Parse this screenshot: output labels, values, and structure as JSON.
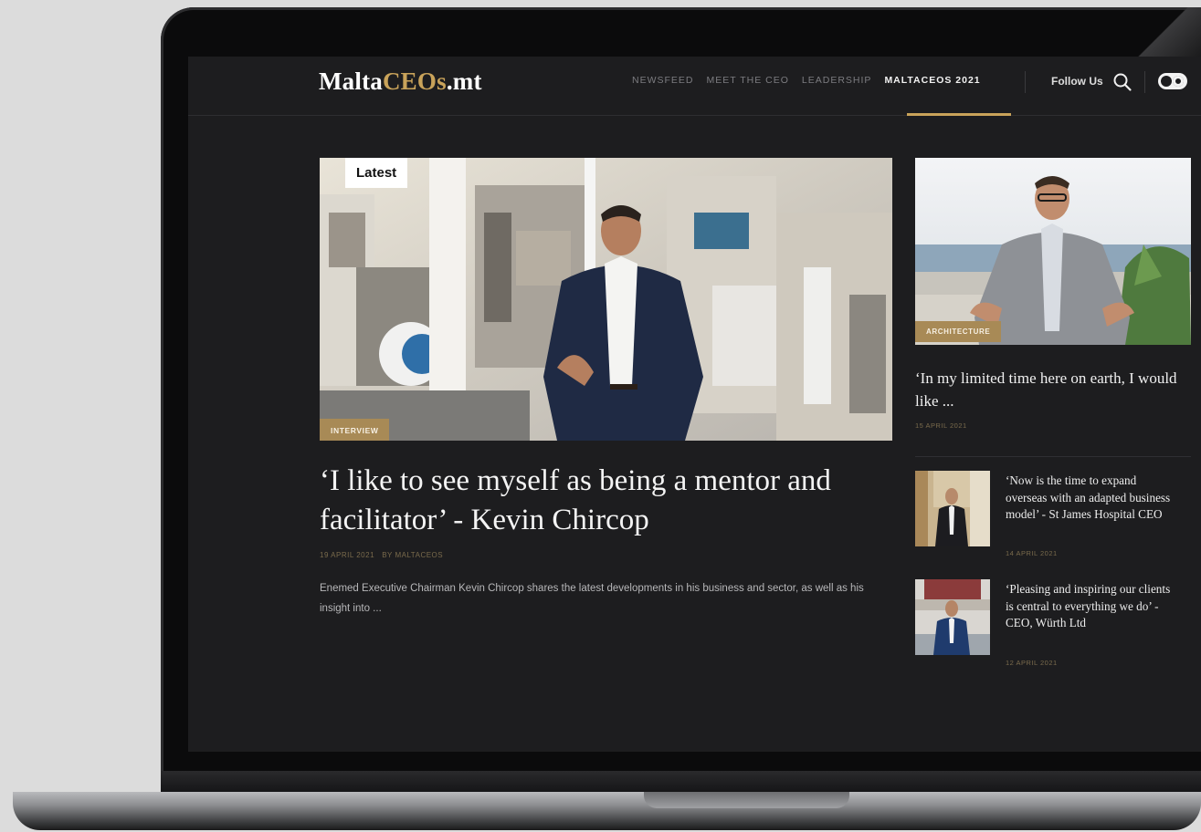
{
  "site": {
    "logo_part1": "Malta",
    "logo_part2": "CEOs",
    "logo_part3": ".mt"
  },
  "nav": {
    "items": [
      {
        "label": "NEWSFEED"
      },
      {
        "label": "MEET THE CEO"
      },
      {
        "label": "LEADERSHIP"
      },
      {
        "label": "MALTACEOS 2021"
      }
    ],
    "follow_label": "Follow Us"
  },
  "feature": {
    "badge": "Latest",
    "category": "INTERVIEW",
    "title": "‘I like to see myself as being a mentor and facilitator’ - Kevin Chircop",
    "date": "19 APRIL 2021",
    "author": "BY MALTACEOS",
    "excerpt": "Enemed Executive Chairman Kevin Chircop shares the latest developments in his business and sector, as well as his insight into ..."
  },
  "side_main": {
    "category": "ARCHITECTURE",
    "title": "‘In my limited time here on earth, I would like ...",
    "date": "15 APRIL 2021"
  },
  "side_list": [
    {
      "title": "‘Now is the time to expand overseas with an adapted business model’ - St James Hospital CEO",
      "date": "14 APRIL 2021"
    },
    {
      "title": "‘Pleasing and inspiring our clients is central to everything we do’ - CEO, Würth Ltd",
      "date": "12 APRIL 2021"
    }
  ],
  "colors": {
    "accent_gold": "#c9a35a",
    "tag_gold": "#a88a56",
    "background": "#1d1d1f"
  }
}
